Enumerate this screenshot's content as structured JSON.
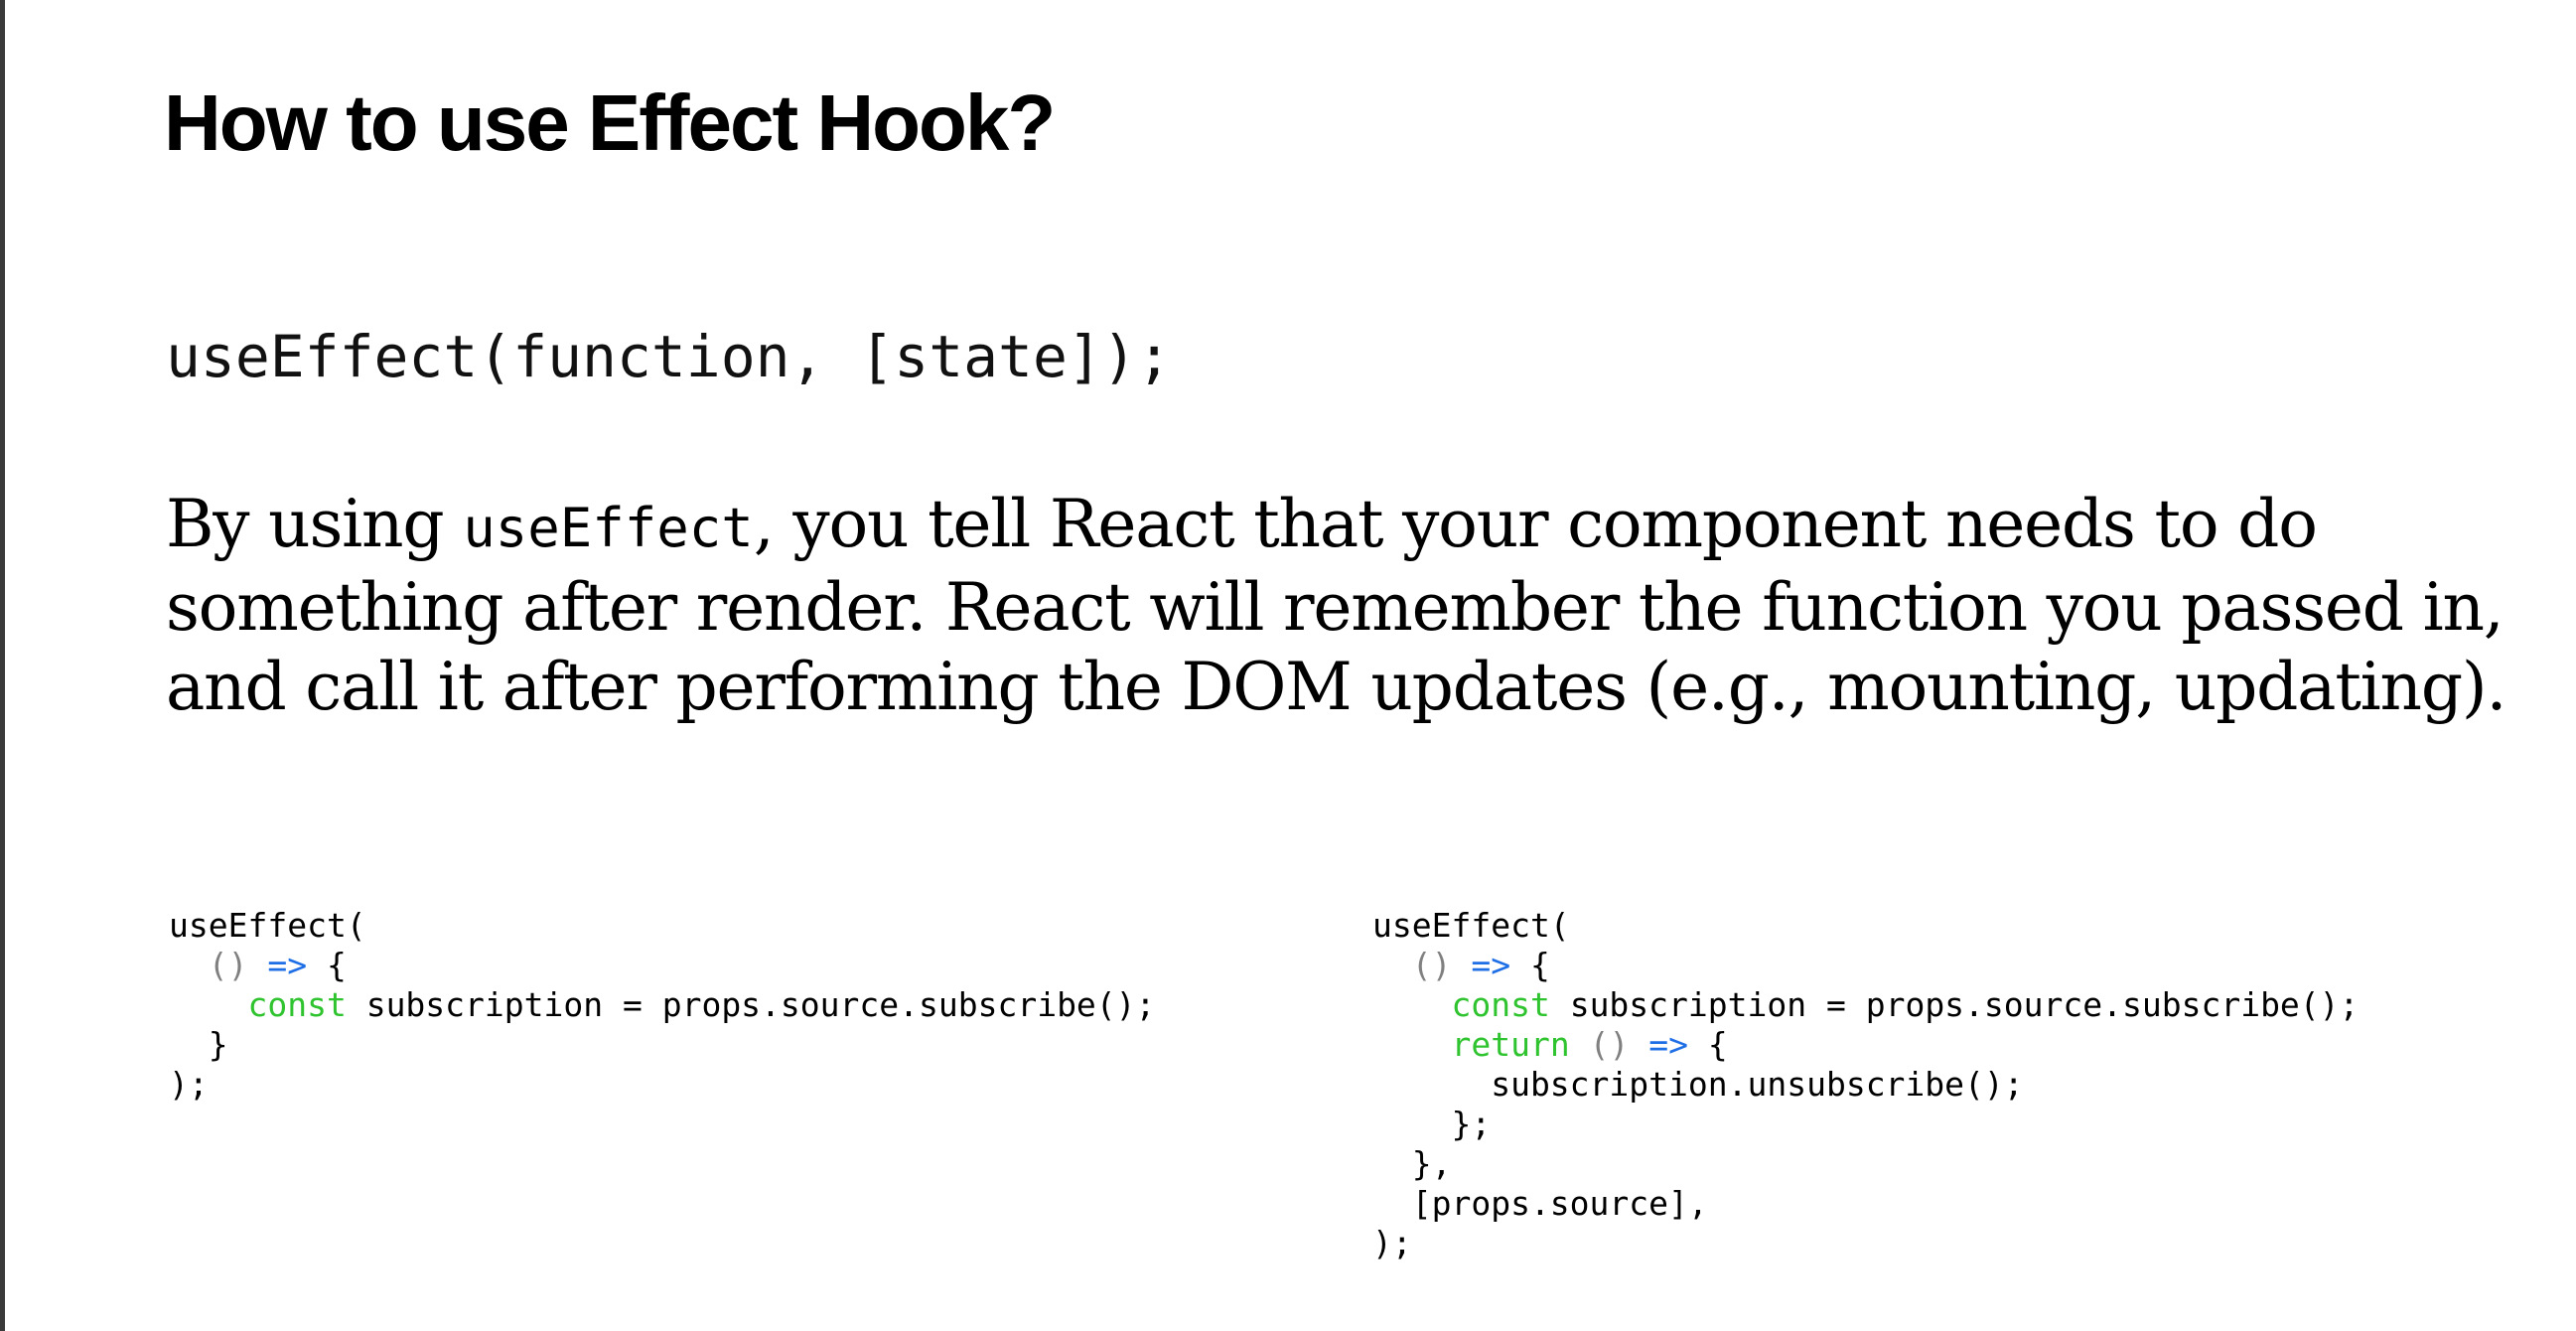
{
  "title": "How to use Effect Hook?",
  "signature": "useEffect(function, [state]);",
  "description": {
    "before": "By using ",
    "code": "useEffect",
    "after": ", you tell React that your component needs to do something after render. React will remember the function you passed in, and call it after performing the DOM updates (e.g., mounting, updating)."
  },
  "code_left": {
    "line1": "useEffect(",
    "line2_indent": "  ",
    "line2_parens": "()",
    "line2_arrow": "=>",
    "line2_brace": "{",
    "line3_indent": "    ",
    "line3_keyword": "const",
    "line3_rest": " subscription = props.source.subscribe();",
    "line4": "  }",
    "line5": ");"
  },
  "code_right": {
    "line1": "useEffect(",
    "line2_indent": "  ",
    "line2_parens": "()",
    "line2_arrow": "=>",
    "line2_brace": "{",
    "line3_indent": "    ",
    "line3_keyword": "const",
    "line3_rest": " subscription = props.source.subscribe();",
    "line4_indent": "    ",
    "line4_keyword": "return",
    "line4_parens": "()",
    "line4_arrow": "=>",
    "line4_brace": "{",
    "line5": "      subscription.unsubscribe();",
    "line6": "    };",
    "line7": "  },",
    "line8": "  [props.source],",
    "line9": ");"
  },
  "colors": {
    "keyword": "#2fc42f",
    "arrow": "#1e6ee6",
    "paren": "#808080"
  }
}
